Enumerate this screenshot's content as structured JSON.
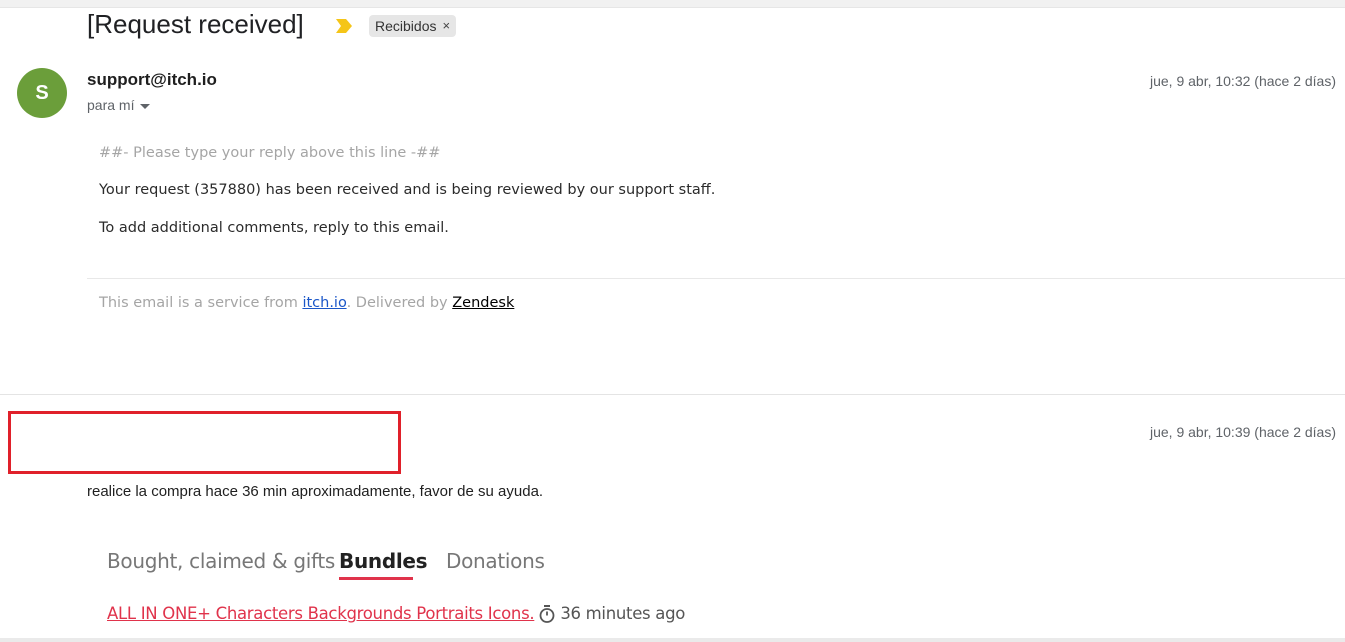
{
  "thread": {
    "subject": "[Request received]",
    "label": "Recibidos",
    "label_remove": "×"
  },
  "message1": {
    "avatar_letter": "S",
    "sender": "support@itch.io",
    "recipient": "para mí",
    "date": "jue, 9 abr, 10:32 (hace 2 días)",
    "reply_marker": "##- Please type your reply above this line -##",
    "line1": "Your request (357880) has been received and is being reviewed by our support staff.",
    "line2": "To add additional comments, reply to this email.",
    "footer": {
      "prefix": "This email is a service from ",
      "link1": "itch.io",
      "middle": ". Delivered by ",
      "link2": "Zendesk"
    }
  },
  "message2": {
    "date": "jue, 9 abr, 10:39 (hace 2 días)",
    "text": "realice la compra hace 36 min aproximadamente, favor de su ayuda.",
    "tabs": [
      {
        "label": "Bought, claimed & gifts"
      },
      {
        "label": "Bundles"
      },
      {
        "label": "Donations"
      }
    ],
    "active_tab": "Bundles",
    "purchase": {
      "title": "ALL IN ONE+ Characters Backgrounds Portraits Icons.",
      "time": "36 minutes ago"
    }
  },
  "colors": {
    "avatar": "#6b9e3a",
    "importance": "#f5c518",
    "itch_red": "#e0334b",
    "redaction": "#e0202a",
    "link_blue": "#1a56c8"
  },
  "icons": {
    "importance": "importance-marker-icon",
    "caret": "chevron-down-icon",
    "timer": "stopwatch-icon"
  }
}
